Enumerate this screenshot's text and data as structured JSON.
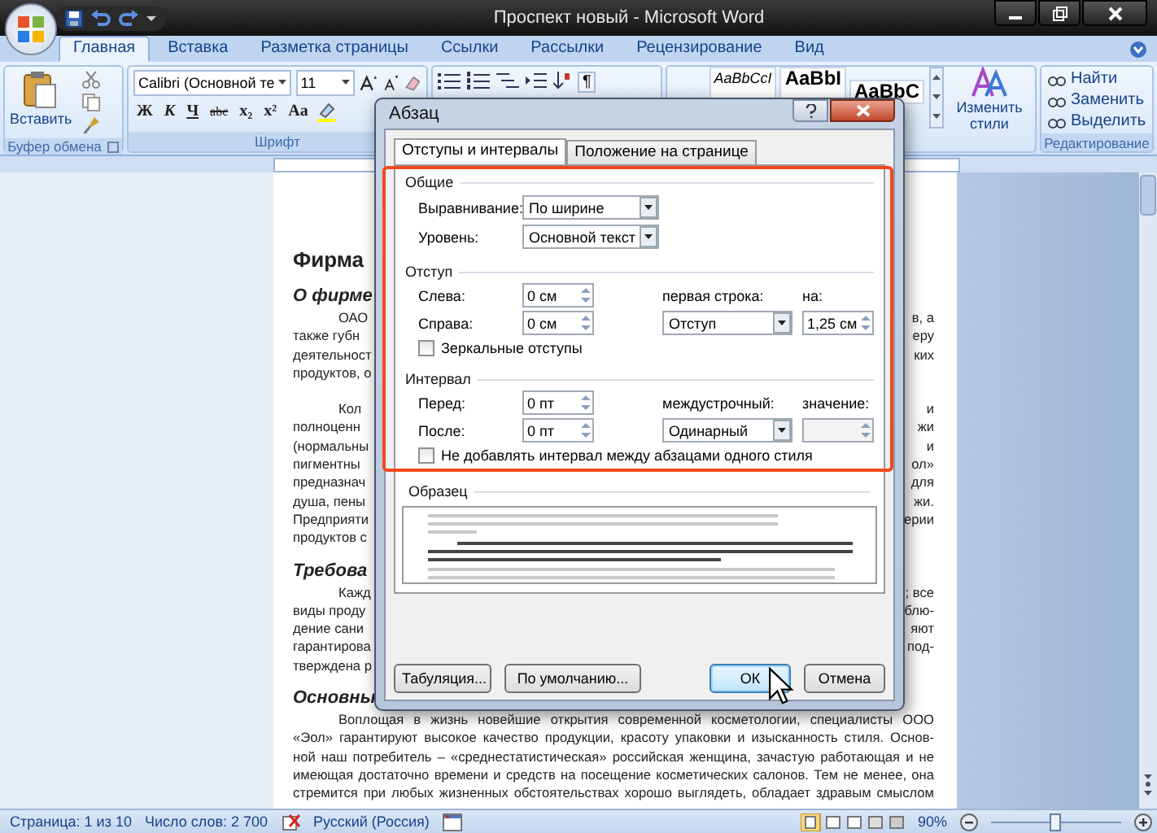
{
  "window": {
    "title": "Проспект новый - Microsoft Word"
  },
  "ribbon_tabs": [
    {
      "label": "Главная",
      "selected": true
    },
    {
      "label": "Вставка",
      "selected": false
    },
    {
      "label": "Разметка страницы",
      "selected": false
    },
    {
      "label": "Ссылки",
      "selected": false
    },
    {
      "label": "Рассылки",
      "selected": false
    },
    {
      "label": "Рецензирование",
      "selected": false
    },
    {
      "label": "Вид",
      "selected": false
    }
  ],
  "ribbon": {
    "clipboard": {
      "paste": "Вставить",
      "label": "Буфер обмена"
    },
    "font": {
      "family": "Calibri (Основной те",
      "size": "11",
      "buttons": [
        "Ж",
        "К",
        "Ч",
        "abc",
        "x₂",
        "x²",
        "Aa"
      ],
      "label": "Шрифт"
    },
    "paragraph": {
      "marks": "¶"
    },
    "styles": {
      "samples": [
        "AaBbCcI",
        "AaBbI",
        "AaBbC"
      ],
      "change": "Изменить стили"
    },
    "editing": {
      "items": [
        "Найти",
        "Заменить",
        "Выделить"
      ],
      "label": "Редактирование"
    }
  },
  "document": {
    "lines": [
      {
        "kind": "heading",
        "left": "Фирма"
      },
      {
        "kind": "subheading",
        "left": "О фирме"
      },
      {
        "kind": "first",
        "left": "ОАО",
        "right": "в, а"
      },
      {
        "kind": "text",
        "left": "также губн",
        "right": "еру"
      },
      {
        "kind": "text",
        "left": "деятельност",
        "right": "ких"
      },
      {
        "kind": "text",
        "left": "продуктов, о"
      },
      {
        "kind": "first",
        "left": "Кол",
        "right": "и"
      },
      {
        "kind": "text",
        "left": "полноценн",
        "right": "жи"
      },
      {
        "kind": "text",
        "left": "(нормальны",
        "right": "и"
      },
      {
        "kind": "text",
        "left": "пигментны",
        "right": "ол»"
      },
      {
        "kind": "text",
        "left": "предназнач",
        "right": "для"
      },
      {
        "kind": "text",
        "left": "душа, пены",
        "right": "жи."
      },
      {
        "kind": "text",
        "left": "Предприяти",
        "right": "ерии"
      },
      {
        "kind": "text",
        "left": "продуктов с"
      },
      {
        "kind": "subheading",
        "left": "Требова"
      },
      {
        "kind": "first",
        "left": "Кажд",
        "right": "; все"
      },
      {
        "kind": "text",
        "left": "виды проду",
        "right": "блю-"
      },
      {
        "kind": "text",
        "left": "дение сани",
        "right": "яют"
      },
      {
        "kind": "text",
        "left": "гарантирова",
        "right": "под-"
      },
      {
        "kind": "text",
        "left": "тверждена р"
      },
      {
        "kind": "subheading",
        "left": "Основны"
      },
      {
        "kind": "first",
        "text": "Воплощая в жизнь новейшие открытия современной косметологии, специалисты ООО"
      },
      {
        "kind": "text",
        "text": "«Эол» гарантируют высокое качество продукции, красоту упаковки и изысканность стиля. Основ-"
      },
      {
        "kind": "text",
        "text": "ной наш потребитель – «среднестатистическая» российская женщина, зачастую работающая и не"
      },
      {
        "kind": "text",
        "text": "имеющая достаточно времени и средств на посещение косметических салонов. Тем не менее, она"
      },
      {
        "kind": "text",
        "text": "стремится при любых жизненных обстоятельствах хорошо выглядеть, обладает здравым смыслом"
      }
    ]
  },
  "dialog": {
    "title": "Абзац",
    "tabs": [
      {
        "label": "Отступы и интервалы",
        "selected": true
      },
      {
        "label": "Положение на странице",
        "selected": false
      }
    ],
    "general": {
      "title": "Общие",
      "alignment": {
        "label": "Выравнивание:",
        "value": "По ширине"
      },
      "level": {
        "label": "Уровень:",
        "value": "Основной текст"
      }
    },
    "indent": {
      "title": "Отступ",
      "left": {
        "label": "Слева:",
        "value": "0 см"
      },
      "right": {
        "label": "Справа:",
        "value": "0 см"
      },
      "first_line": {
        "label": "первая строка:",
        "value": "Отступ"
      },
      "by": {
        "label": "на:",
        "value": "1,25 см"
      },
      "mirror": {
        "label": "Зеркальные отступы",
        "checked": false
      }
    },
    "spacing": {
      "title": "Интервал",
      "before": {
        "label": "Перед:",
        "value": "0 пт"
      },
      "after": {
        "label": "После:",
        "value": "0 пт"
      },
      "line": {
        "label": "междустрочный:",
        "value": "Одинарный"
      },
      "at": {
        "label": "значение:"
      },
      "no_space": {
        "label": "Не добавлять интервал между абзацами одного стиля",
        "checked": false
      }
    },
    "sample": {
      "title": "Образец"
    },
    "buttons": [
      {
        "label": "Табуляция...",
        "default": false
      },
      {
        "label": "По умолчанию...",
        "default": false
      },
      {
        "label": "ОК",
        "default": true
      },
      {
        "label": "Отмена",
        "default": false
      }
    ]
  },
  "status_bar": {
    "page": "Страница: 1 из 10",
    "words": "Число слов: 2 700",
    "language": "Русский (Россия)",
    "zoom": {
      "label": "90%",
      "level": 0.45
    }
  }
}
